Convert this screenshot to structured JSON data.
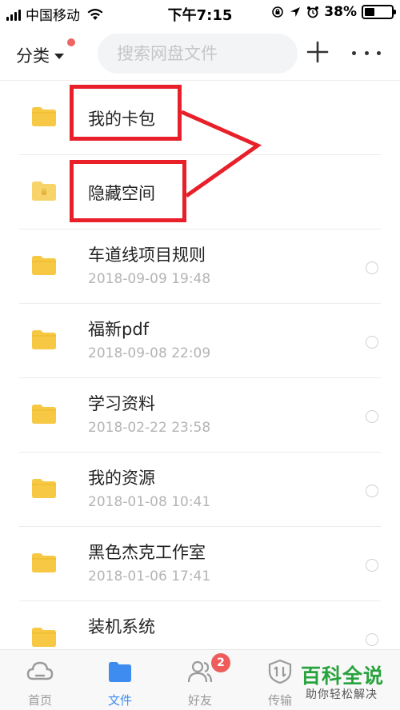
{
  "status_bar": {
    "carrier": "中国移动",
    "time": "下午7:15",
    "battery": "38%",
    "battery_level": 0.38
  },
  "header": {
    "category_label": "分类",
    "search_placeholder": "搜索网盘文件"
  },
  "files": [
    {
      "name": "我的卡包",
      "date": ""
    },
    {
      "name": "隐藏空间",
      "date": ""
    },
    {
      "name": "车道线项目规则",
      "date": "2018-09-09 19:48"
    },
    {
      "name": "福新pdf",
      "date": "2018-09-08 22:09"
    },
    {
      "name": "学习资料",
      "date": "2018-02-22 23:58"
    },
    {
      "name": "我的资源",
      "date": "2018-01-08 10:41"
    },
    {
      "name": "黑色杰克工作室",
      "date": "2018-01-06 17:41"
    },
    {
      "name": "装机系统",
      "date": ""
    }
  ],
  "bottom_nav": {
    "tabs": [
      {
        "label": "首页",
        "icon": "cloud-icon"
      },
      {
        "label": "文件",
        "icon": "folder-icon"
      },
      {
        "label": "好友",
        "icon": "friends-icon"
      },
      {
        "label": "传输",
        "icon": "transfer-icon"
      }
    ],
    "friends_badge": "2"
  },
  "watermark": {
    "title": "百科全说",
    "subtitle": "助你轻松解决"
  },
  "colors": {
    "accent": "#3f8cf0",
    "annotation": "#e8202a",
    "folder": "#f6c844",
    "watermark": "#27a23c"
  }
}
